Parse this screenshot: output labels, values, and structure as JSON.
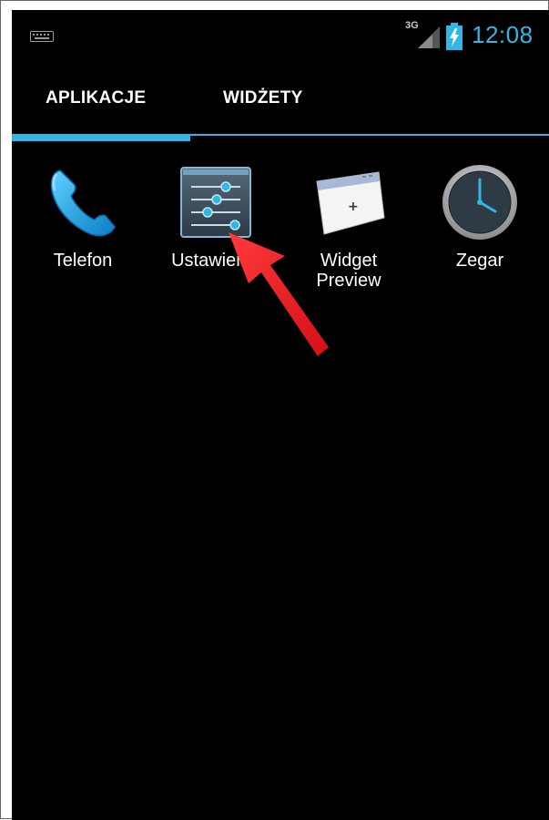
{
  "statusbar": {
    "network": "3G",
    "time": "12:08",
    "icons": [
      "keyboard-icon",
      "signal-icon",
      "battery-charging-icon"
    ]
  },
  "tabs": [
    {
      "label": "APLIKACJE",
      "selected": true
    },
    {
      "label": "WIDŻETY",
      "selected": false
    }
  ],
  "apps": [
    {
      "label": "Telefon",
      "icon": "phone-icon"
    },
    {
      "label": "Ustawienia",
      "icon": "settings-sliders-icon"
    },
    {
      "label": "Widget Preview",
      "icon": "widget-preview-icon"
    },
    {
      "label": "Zegar",
      "icon": "clock-icon"
    }
  ],
  "annotation": {
    "icon": "red-arrow-icon"
  },
  "colors": {
    "accent": "#33b5e5",
    "background": "#000000",
    "arrow": "#ee1c24"
  }
}
